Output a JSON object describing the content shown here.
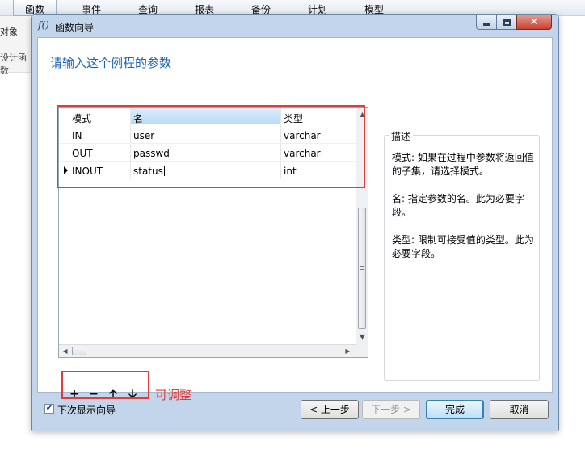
{
  "menubar": {
    "items": [
      "函数",
      "事件",
      "查询",
      "报表",
      "备份",
      "计划",
      "模型"
    ]
  },
  "background": {
    "side_text_1": "对象",
    "side_text_2": "设计函数"
  },
  "window": {
    "icon_glyph": "f()",
    "title": "函数向导"
  },
  "heading": "请输入这个例程的参数",
  "grid": {
    "columns": [
      "模式",
      "名",
      "类型"
    ],
    "rows": [
      {
        "mode": "IN",
        "name": "user",
        "type": "varchar"
      },
      {
        "mode": "OUT",
        "name": "passwd",
        "type": "varchar"
      },
      {
        "mode": "INOUT",
        "name": "status",
        "type": "int"
      }
    ]
  },
  "toolbar": {
    "add": "+",
    "remove": "−",
    "up": "🡡",
    "down": "🡣"
  },
  "annotation": "可调整",
  "description": {
    "title": "描述",
    "paragraphs": [
      "模式: 如果在过程中参数将返回值的子集，请选择模式。",
      "名: 指定参数的名。此为必要字段。",
      "类型: 限制可接受值的类型。此为必要字段。"
    ]
  },
  "footer": {
    "show_wizard_label": "下次显示向导",
    "show_wizard_checked": true,
    "prev": "< 上一步",
    "next": "下一步 >",
    "finish": "完成",
    "cancel": "取消"
  },
  "colors": {
    "accent": "#1e64b4",
    "annotation_red": "#e23b3b",
    "window_frame": "#c3d5ea"
  }
}
